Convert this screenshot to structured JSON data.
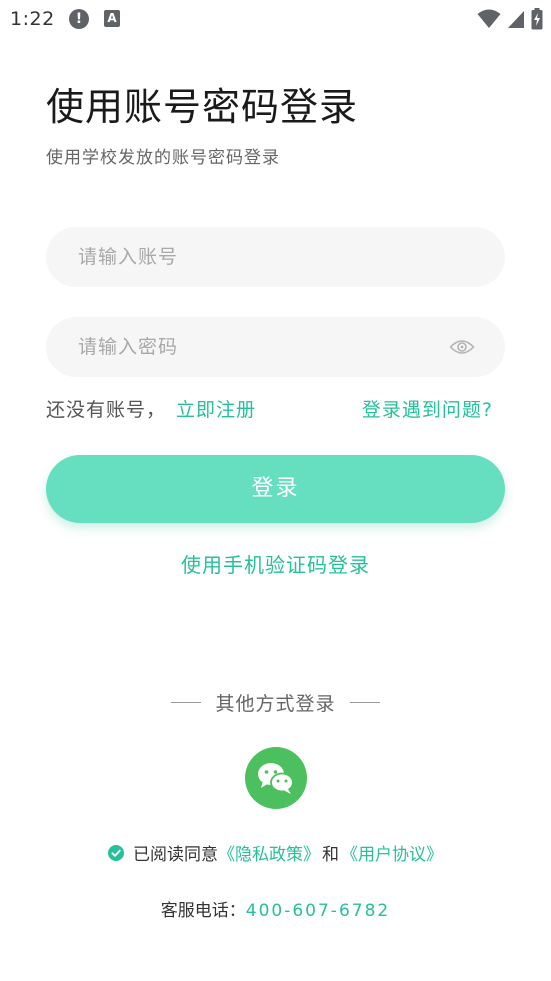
{
  "status_bar": {
    "time": "1:22",
    "alert_glyph": "!",
    "badge_glyph": "A",
    "icons": [
      "alert-icon",
      "a-badge-icon",
      "wifi-icon",
      "signal-icon",
      "battery-charging-icon"
    ]
  },
  "header": {
    "title": "使用账号密码登录",
    "subtitle": "使用学校发放的账号密码登录"
  },
  "form": {
    "account_placeholder": "请输入账号",
    "account_value": "",
    "password_placeholder": "请输入密码",
    "password_value": "",
    "eye_icon": "eye-icon"
  },
  "links": {
    "no_account": "还没有账号，",
    "register": "立即注册",
    "problem": "登录遇到问题?"
  },
  "login_button": "登录",
  "sms_login": "使用手机验证码登录",
  "other_methods": {
    "label": "其他方式登录",
    "wechat_icon": "wechat-icon"
  },
  "agreement": {
    "checked": true,
    "prefix": "已阅读同意",
    "privacy": "《隐私政策》",
    "and": "和",
    "user_agreement": "《用户协议》"
  },
  "service": {
    "label": "客服电话：",
    "phone": "400-607-6782"
  },
  "colors": {
    "accent": "#27c09b",
    "button": "#66dfc1",
    "wechat": "#4cc05e",
    "input_bg": "#f6f6f6"
  }
}
